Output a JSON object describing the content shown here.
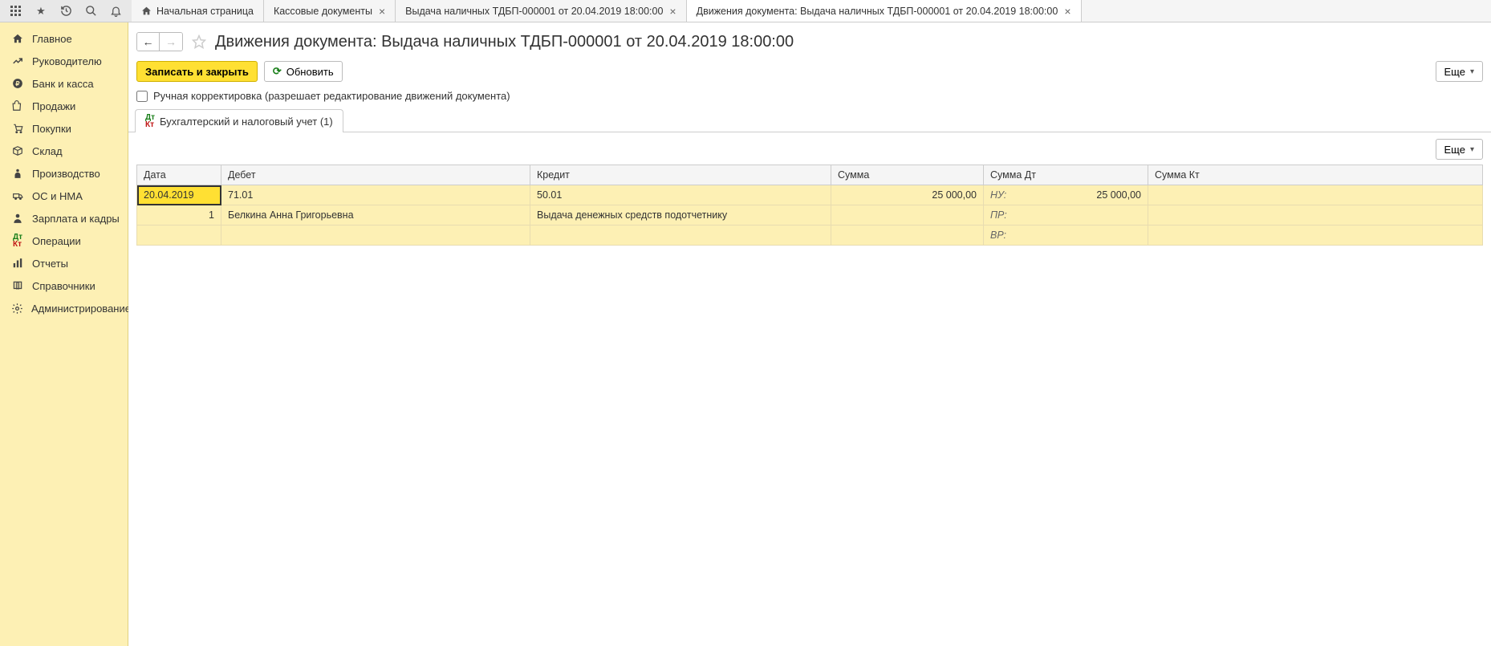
{
  "topTabs": [
    {
      "label": "Начальная страница",
      "closable": false,
      "home": true
    },
    {
      "label": "Кассовые документы",
      "closable": true
    },
    {
      "label": "Выдача наличных ТДБП-000001 от 20.04.2019 18:00:00",
      "closable": true
    },
    {
      "label": "Движения документа: Выдача наличных ТДБП-000001 от 20.04.2019 18:00:00",
      "closable": true,
      "active": true
    }
  ],
  "sidebar": [
    {
      "icon": "home",
      "label": "Главное"
    },
    {
      "icon": "trend",
      "label": "Руководителю"
    },
    {
      "icon": "ruble",
      "label": "Банк и касса"
    },
    {
      "icon": "bag",
      "label": "Продажи"
    },
    {
      "icon": "cart",
      "label": "Покупки"
    },
    {
      "icon": "box",
      "label": "Склад"
    },
    {
      "icon": "workman",
      "label": "Производство"
    },
    {
      "icon": "truck",
      "label": "ОС и НМА"
    },
    {
      "icon": "person",
      "label": "Зарплата и кадры"
    },
    {
      "icon": "dtkt",
      "label": "Операции"
    },
    {
      "icon": "bars",
      "label": "Отчеты"
    },
    {
      "icon": "book",
      "label": "Справочники"
    },
    {
      "icon": "gear",
      "label": "Администрирование"
    }
  ],
  "page": {
    "title": "Движения документа: Выдача наличных ТДБП-000001 от 20.04.2019 18:00:00",
    "saveClose": "Записать и закрыть",
    "refresh": "Обновить",
    "more": "Еще",
    "manualCorrection": "Ручная корректировка (разрешает редактирование движений документа)",
    "subtab": "Бухгалтерский и налоговый учет (1)"
  },
  "grid": {
    "headers": {
      "date": "Дата",
      "debet": "Дебет",
      "kredit": "Кредит",
      "summa": "Сумма",
      "summaDt": "Сумма Дт",
      "summaKt": "Сумма Кт"
    },
    "row": {
      "date": "20.04.2019",
      "num": "1",
      "debetAcc": "71.01",
      "debetSub": "Белкина Анна Григорьевна",
      "kreditAcc": "50.01",
      "kreditSub": "Выдача денежных средств подотчетнику",
      "summa": "25 000,00",
      "nu": "НУ:",
      "nuVal": "25 000,00",
      "pr": "ПР:",
      "vr": "ВР:"
    }
  }
}
